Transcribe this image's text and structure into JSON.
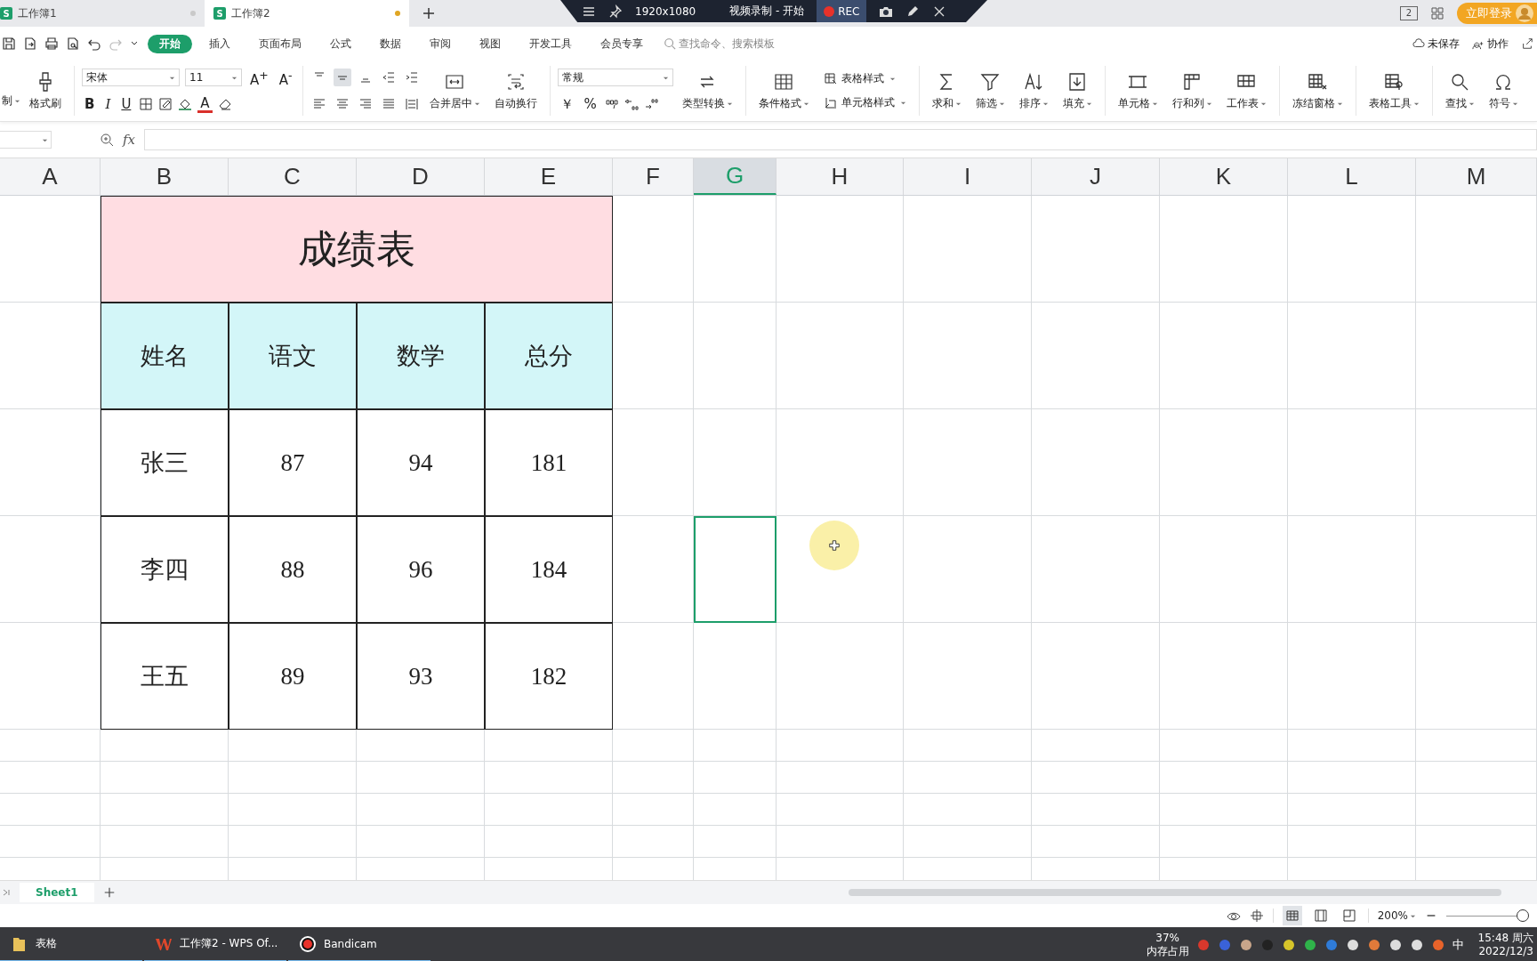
{
  "tabs": [
    {
      "icon_letter": "S",
      "label": "工作簿1",
      "selected": false,
      "modified": false
    },
    {
      "icon_letter": "S",
      "label": "工作簿2",
      "selected": true,
      "modified": true
    }
  ],
  "recorder": {
    "resolution": "1920x1080",
    "title": "视频录制 - 开始",
    "rec": "REC"
  },
  "account": {
    "layout_badge": "2",
    "login": "立即登录"
  },
  "menu": {
    "items": [
      {
        "label": "开始",
        "selected": true
      },
      {
        "label": "插入",
        "selected": false
      },
      {
        "label": "页面布局",
        "selected": false
      },
      {
        "label": "公式",
        "selected": false
      },
      {
        "label": "数据",
        "selected": false
      },
      {
        "label": "审阅",
        "selected": false
      },
      {
        "label": "视图",
        "selected": false
      },
      {
        "label": "开发工具",
        "selected": false
      },
      {
        "label": "会员专享",
        "selected": false
      }
    ],
    "search": {
      "placeholder": "查找命令、搜索模板"
    },
    "actions": [
      "未保存",
      "协作"
    ]
  },
  "ribbon": {
    "clipboard": {
      "cut": "制",
      "painter": "格式刷"
    },
    "font": {
      "name": "宋体",
      "size": "11",
      "grow": "A$^{+}$",
      "shrink": "A$^{-}$",
      "styles": [
        "B",
        "I",
        "U"
      ],
      "color_letter": "A"
    },
    "align": {
      "vertical": [
        {
          "selected": false
        },
        {
          "selected": true
        },
        {
          "selected": false
        }
      ],
      "merge": "合并居中",
      "wrap": "自动换行"
    },
    "number": {
      "format": "常规",
      "currency": "￥",
      "percent": "%",
      "convert": "类型转换"
    },
    "styles": {
      "conditional": "条件格式",
      "stack": [
        "表格样式",
        "单元格样式"
      ]
    },
    "tools": [
      "求和",
      "筛选",
      "排序",
      "填充",
      "单元格",
      "行和列",
      "工作表",
      "冻结窗格",
      "表格工具",
      "查找",
      "符号"
    ]
  },
  "formula_bar": {
    "fx": "fx"
  },
  "sheet": {
    "columns": [
      {
        "label": "A",
        "selected": false
      },
      {
        "label": "B",
        "selected": false
      },
      {
        "label": "C",
        "selected": false
      },
      {
        "label": "D",
        "selected": false
      },
      {
        "label": "E",
        "selected": false
      },
      {
        "label": "F",
        "selected": false
      },
      {
        "label": "G",
        "selected": true
      },
      {
        "label": "H",
        "selected": false
      },
      {
        "label": "I",
        "selected": false
      },
      {
        "label": "J",
        "selected": false
      },
      {
        "label": "K",
        "selected": false
      },
      {
        "label": "L",
        "selected": false
      },
      {
        "label": "M",
        "selected": false
      }
    ],
    "title": "成绩表",
    "header": [
      "姓名",
      "语文",
      "数学",
      "总分"
    ],
    "rows": [
      {
        "cells": [
          "",
          "张三",
          "87",
          "94",
          "181"
        ],
        "active": false
      },
      {
        "cells": [
          "",
          "李四",
          "88",
          "96",
          "184"
        ],
        "active": true
      },
      {
        "cells": [
          "",
          "王五",
          "89",
          "93",
          "182"
        ],
        "active": false
      }
    ]
  },
  "sheet_tabs": [
    {
      "label": "Sheet1",
      "selected": true
    }
  ],
  "status_bar": {
    "view_modes": [
      {
        "selected": true
      },
      {
        "selected": false
      },
      {
        "selected": false
      }
    ],
    "zoom": "200%",
    "zoom_slider": {
      "level": 0.94
    }
  },
  "taskbar": {
    "apps": [
      {
        "label": "表格"
      },
      {
        "label": "工作簿2 - WPS Of..."
      },
      {
        "label": "Bandicam"
      }
    ],
    "memory": {
      "percent": "37%",
      "label": "内存占用"
    },
    "ime": "中",
    "time": "15:48 周六",
    "date": "2022/12/3"
  }
}
